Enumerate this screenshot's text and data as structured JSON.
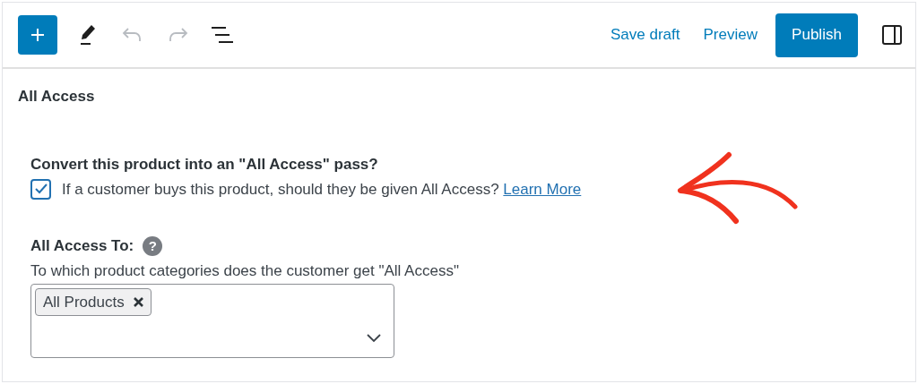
{
  "toolbar": {
    "tools": [
      {
        "kind": "add",
        "disabled": false
      },
      {
        "kind": "edit",
        "disabled": false
      },
      {
        "kind": "undo",
        "disabled": true
      },
      {
        "kind": "redo",
        "disabled": true
      },
      {
        "kind": "outline",
        "disabled": false
      }
    ],
    "links": [
      "Save draft",
      "Preview"
    ],
    "primary": "Publish"
  },
  "panel": {
    "title": "All Access",
    "convert": {
      "heading": "Convert this product into an \"All Access\" pass?",
      "checked": true,
      "label": "If a customer buys this product, should they be given All Access?",
      "link": "Learn More"
    },
    "access_to": {
      "label": "All Access To:",
      "help": "?",
      "description": "To which product categories does the customer get \"All Access\"",
      "tags": [
        "All Products"
      ]
    }
  }
}
